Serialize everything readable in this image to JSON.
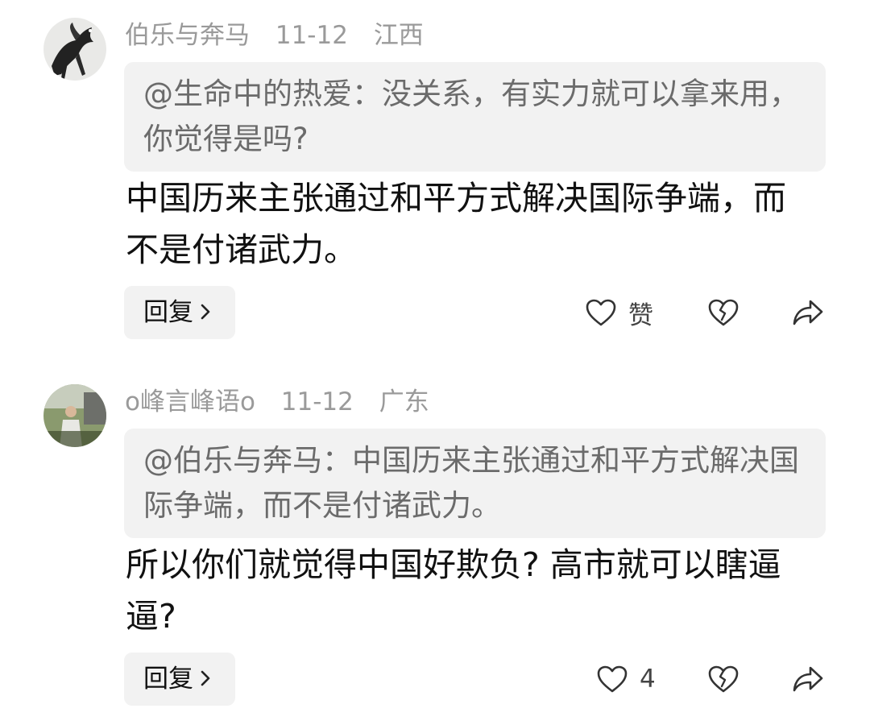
{
  "comments": [
    {
      "username": "伯乐与奔马",
      "date": "11-12",
      "location": "江西",
      "quote_text": "@生命中的热爱：没关系，有实力就可以拿来用，你觉得是吗?",
      "body": "中国历来主张通过和平方式解决国际争端，而不是付诸武力。",
      "reply_label": "回复",
      "like_label": "赞",
      "icons": {
        "avatar": "horse-painting-avatar",
        "like": "heart-outline-icon",
        "dislike": "broken-heart-icon",
        "share": "share-arrow-icon"
      }
    },
    {
      "username": "o峰言峰语o",
      "date": "11-12",
      "location": "广东",
      "quote_text": "@伯乐与奔马：中国历来主张通过和平方式解决国际争端，而不是付诸武力。",
      "body": "所以你们就觉得中国好欺负? 高市就可以瞎逼逼?",
      "reply_label": "回复",
      "like_label": "4",
      "icons": {
        "avatar": "person-photo-avatar",
        "like": "heart-outline-icon",
        "dislike": "broken-heart-icon",
        "share": "share-arrow-icon"
      }
    }
  ],
  "colors": {
    "meta_text": "#9a9a9a",
    "quote_bg": "#f2f2f2",
    "quote_text": "#6b6b6b",
    "body_text": "#111111",
    "icon_stroke": "#333333"
  }
}
